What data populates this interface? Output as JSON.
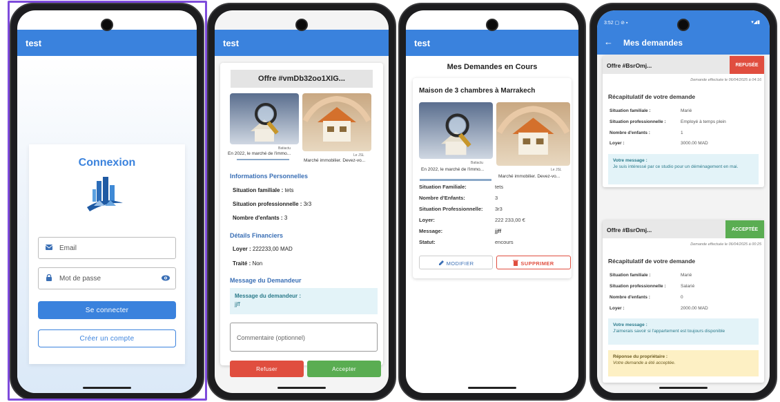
{
  "phone1": {
    "appbar_title": "test",
    "login_title": "Connexion",
    "email_placeholder": "Email",
    "password_placeholder": "Mot de passe",
    "login_button": "Se connecter",
    "create_account_button": "Créer un compte"
  },
  "phone2": {
    "appbar_title": "test",
    "offer_title": "Offre #vmDb32oo1XIG...",
    "thumbs": [
      {
        "source": "Batiactu",
        "caption": "En 2022, le marché de l'immo..."
      },
      {
        "source": "Le JSL",
        "caption": "Marché immobilier. Devez-vo..."
      }
    ],
    "personal_title": "Informations Personnelles",
    "personal": [
      {
        "label": "Situation familiale :",
        "value": "tets"
      },
      {
        "label": "Situation professionnelle :",
        "value": "3r3"
      },
      {
        "label": "Nombre d'enfants :",
        "value": "3"
      }
    ],
    "finance_title": "Détails Financiers",
    "finance": [
      {
        "label": "Loyer :",
        "value": "222233,00 MAD"
      },
      {
        "label": "Traité :",
        "value": "Non"
      }
    ],
    "message_title": "Message du Demandeur",
    "message_label": "Message du demandeur :",
    "message_text": "jjff",
    "comment_placeholder": "Commentaire (optionnel)",
    "refuse_button": "Refuser",
    "accept_button": "Accepter"
  },
  "phone3": {
    "appbar_title": "test",
    "page_title": "Mes Demandes en Cours",
    "card_title": "Maison de 3 chambres à Marrakech",
    "thumbs": [
      {
        "source": "Batiactu",
        "caption": "En 2022, le marché de l'immo..."
      },
      {
        "source": "Le JSL",
        "caption": "Marché immobilier. Devez-vo..."
      }
    ],
    "rows": [
      {
        "label": "Situation Familiale:",
        "value": "tets"
      },
      {
        "label": "Nombre d'Enfants:",
        "value": "3"
      },
      {
        "label": "Situation Professionnelle:",
        "value": "3r3"
      },
      {
        "label": "Loyer:",
        "value": "222 233,00 €"
      },
      {
        "label": "Message:",
        "value": "jjff"
      },
      {
        "label": "Statut:",
        "value": "encours"
      }
    ],
    "modify_button": "MODIFIER",
    "delete_button": "SUPPRIMER"
  },
  "phone4": {
    "status_time": "3:52",
    "title": "Mes demandes",
    "cards": [
      {
        "offer": "Offre #BsrOmj...",
        "badge": "REFUSÉE",
        "date": "Demande effectuée le 06/04/2025 à 04:16",
        "summary_title": "Récapitulatif de votre demande",
        "rows": [
          {
            "label": "Situation familiale :",
            "value": "Marié"
          },
          {
            "label": "Situation professionnelle :",
            "value": "Employé à temps plein"
          },
          {
            "label": "Nombre d'enfants :",
            "value": "1"
          },
          {
            "label": "Loyer :",
            "value": "3000.00 MAD"
          }
        ],
        "message_label": "Votre message :",
        "message_text": "Je suis intéressé par ce studio pour un déménagement en mai."
      },
      {
        "offer": "Offre #BsrOmj...",
        "badge": "ACCEPTÉE",
        "date": "Demande effectuée le 06/04/2025 à 00:25",
        "summary_title": "Récapitulatif de votre demande",
        "rows": [
          {
            "label": "Situation familiale :",
            "value": "Marié"
          },
          {
            "label": "Situation professionnelle :",
            "value": "Salarié"
          },
          {
            "label": "Nombre d'enfants :",
            "value": "0"
          },
          {
            "label": "Loyer :",
            "value": "2000.00 MAD"
          }
        ],
        "message_label": "Votre message :",
        "message_text": "J'aimerais savoir si l'appartement est toujours disponible",
        "reply_label": "Réponse du propriétaire :",
        "reply_text": "Votre demande a été acceptée."
      }
    ]
  },
  "colors": {
    "primary": "#3a82dd",
    "selection": "#7e4bdb",
    "refuse": "#e04e3f",
    "accept": "#5aad52"
  }
}
